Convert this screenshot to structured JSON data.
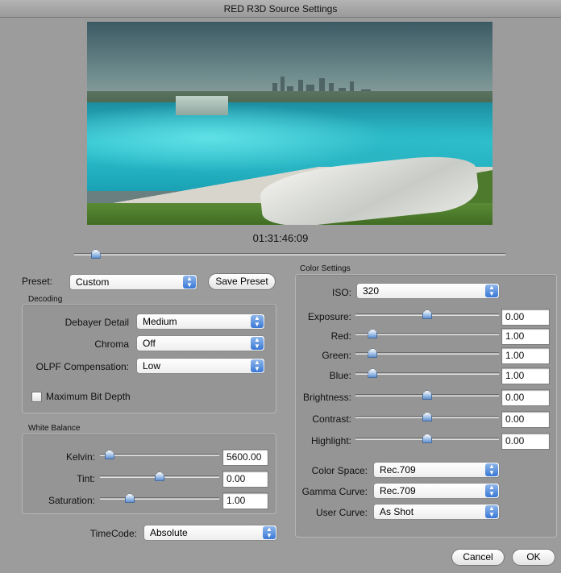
{
  "window": {
    "title": "RED R3D Source Settings"
  },
  "preview": {
    "timecode": "01:31:46:09",
    "scrub_position": 0.05
  },
  "preset": {
    "label": "Preset:",
    "value": "Custom",
    "save_label": "Save Preset"
  },
  "decoding": {
    "title": "Decoding",
    "debayer_label": "Debayer Detail",
    "debayer_value": "Medium",
    "chroma_label": "Chroma",
    "chroma_value": "Off",
    "olpf_label": "OLPF Compensation:",
    "olpf_value": "Low",
    "max_bit_depth_label": "Maximum Bit Depth",
    "max_bit_depth_checked": false
  },
  "white_balance": {
    "title": "White Balance",
    "kelvin_label": "Kelvin:",
    "kelvin_value": "5600.00",
    "kelvin_pos": 0.08,
    "tint_label": "Tint:",
    "tint_value": "0.00",
    "tint_pos": 0.5,
    "saturation_label": "Saturation:",
    "saturation_value": "1.00",
    "saturation_pos": 0.25
  },
  "timecode": {
    "label": "TimeCode:",
    "value": "Absolute"
  },
  "color_settings": {
    "title": "Color Settings",
    "iso_label": "ISO:",
    "iso_value": "320",
    "exposure_label": "Exposure:",
    "exposure_value": "0.00",
    "exposure_pos": 0.5,
    "red_label": "Red:",
    "red_value": "1.00",
    "red_pos": 0.12,
    "green_label": "Green:",
    "green_value": "1.00",
    "green_pos": 0.12,
    "blue_label": "Blue:",
    "blue_value": "1.00",
    "blue_pos": 0.12,
    "brightness_label": "Brightness:",
    "brightness_value": "0.00",
    "brightness_pos": 0.5,
    "contrast_label": "Contrast:",
    "contrast_value": "0.00",
    "contrast_pos": 0.5,
    "highlight_label": "Highlight:",
    "highlight_value": "0.00",
    "highlight_pos": 0.5,
    "color_space_label": "Color Space:",
    "color_space_value": "Rec.709",
    "gamma_label": "Gamma Curve:",
    "gamma_value": "Rec.709",
    "user_curve_label": "User Curve:",
    "user_curve_value": "As Shot"
  },
  "footer": {
    "cancel_label": "Cancel",
    "ok_label": "OK"
  }
}
